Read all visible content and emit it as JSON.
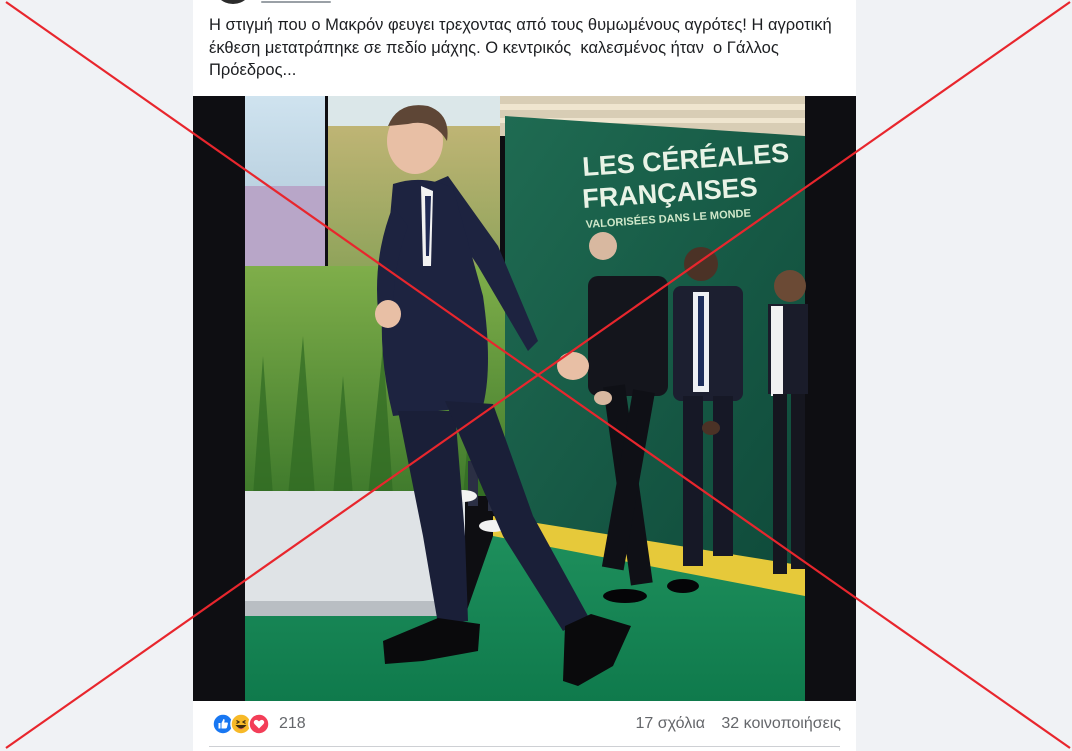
{
  "post": {
    "text": "Η στιγμή που ο Μακρόν φευγει τρεχοντας από τους θυμωμένους αγρότες! Η αγροτική έκθεση μετατράπηκε σε πεδίο μάχης. Ο κεντρικός  καλεσμένος ήταν  ο Γάλλος Πρόεδρος...",
    "image": {
      "banner_line1": "LES CÉRÉALES",
      "banner_line2": "FRANÇAISES",
      "banner_line3": "VALORISÉES DANS LE MONDE"
    }
  },
  "footer": {
    "reaction_count": "218",
    "comments": "17 σχόλια",
    "shares": "32 κοινοποιήσεις",
    "reactions": [
      "like-icon",
      "haha-icon",
      "love-icon"
    ]
  },
  "colors": {
    "page_bg": "#f0f2f5",
    "card_bg": "#ffffff",
    "text": "#1c1e21",
    "muted": "#65676b",
    "like_blue": "#1877f2",
    "love_red": "#f33e58",
    "haha_yellow": "#f7b928",
    "cross_red": "#e8262d"
  },
  "overlay": {
    "icon": "red-x-cross"
  }
}
